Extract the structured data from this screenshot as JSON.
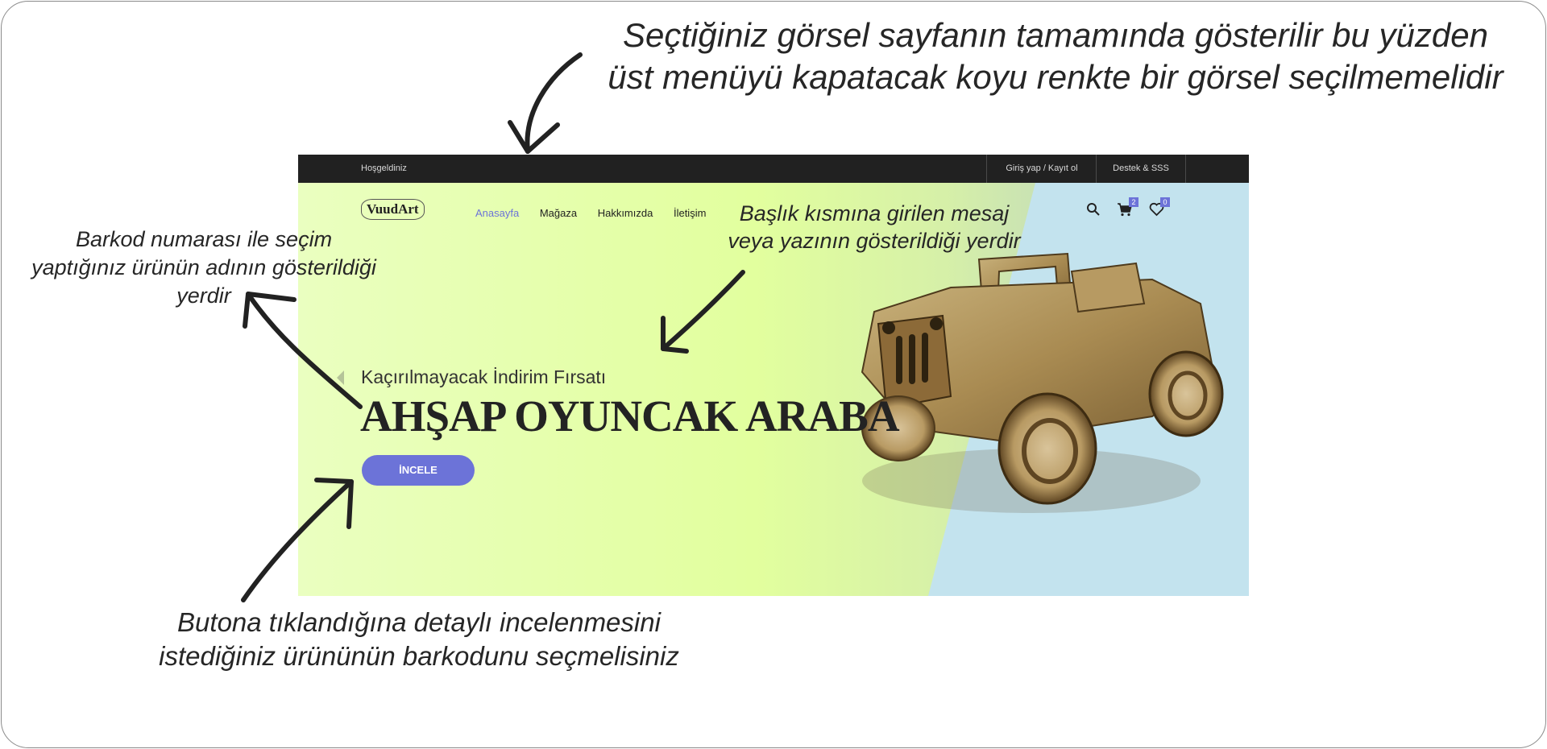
{
  "annotations": {
    "top": [
      "Seçtiğiniz görsel sayfanın tamamında gösterilir bu yüzden",
      "üst menüyü kapatacak koyu renkte bir görsel seçilmemelidir"
    ],
    "left": [
      "Barkod numarası ile seçim",
      "yaptığınız ürünün adının gösterildiği",
      "yerdir"
    ],
    "title_area": [
      "Başlık kısmına girilen mesaj",
      "veya yazının gösterildiği yerdir"
    ],
    "bottom": [
      "Butona tıklandığına detaylı incelenmesini",
      "istediğiniz ürününün barkodunu seçmelisiniz"
    ]
  },
  "topbar": {
    "welcome": "Hoşgeldiniz",
    "login": "Giriş yap / Kayıt ol",
    "support": "Destek & SSS"
  },
  "header": {
    "logo": "VuudArt",
    "nav": [
      "Anasayfa",
      "Mağaza",
      "Hakkımızda",
      "İletişim"
    ],
    "cart_count": "2",
    "wishlist_count": "0"
  },
  "hero": {
    "subtitle": "Kaçırılmayacak İndirim Fırsatı",
    "title": "AHŞAP OYUNCAK ARABA",
    "button": "İNCELE"
  },
  "colors": {
    "accent": "#6c73d8",
    "topbar": "#212121",
    "hero_green": "#e2ff9e",
    "hero_blue": "#c3e3ee"
  },
  "icons": [
    "search-icon",
    "cart-icon",
    "heart-icon",
    "arrow-icon",
    "jeep-image"
  ]
}
